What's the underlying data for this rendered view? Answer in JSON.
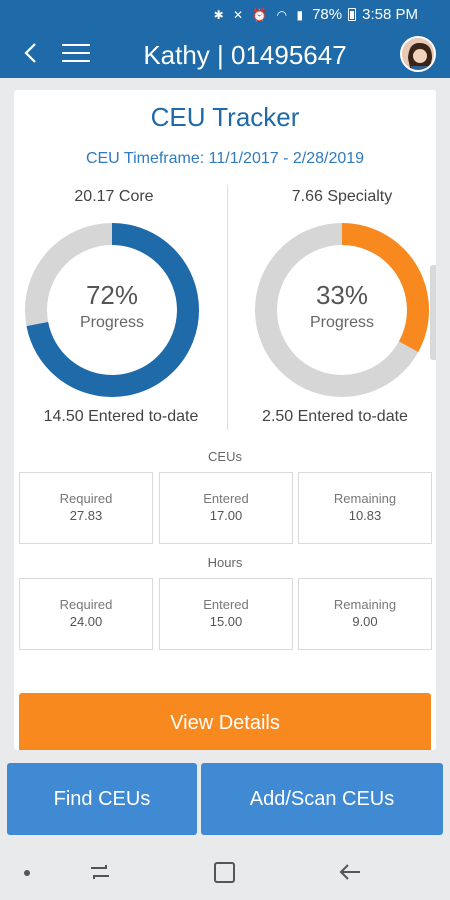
{
  "status_bar": {
    "icons": [
      "bluetooth-icon",
      "mute-icon",
      "alarm-icon",
      "wifi-icon",
      "signal-icon",
      "battery-icon"
    ],
    "battery": "78%",
    "time": "3:58 PM"
  },
  "header": {
    "title": "Kathy | 01495647",
    "accent": "#1f6aa8"
  },
  "tracker": {
    "title": "CEU Tracker",
    "timeframe": "CEU Timeframe: 11/1/2017 - 2/28/2019",
    "core": {
      "heading": "20.17 Core",
      "percent_text": "72%",
      "progress_fraction": 0.72,
      "progress_label": "Progress",
      "entered": "14.50 Entered to-date",
      "color": "#1f6aa8"
    },
    "specialty": {
      "heading": "7.66 Specialty",
      "percent_text": "33%",
      "progress_fraction": 0.33,
      "progress_label": "Progress",
      "entered": "2.50 Entered to-date",
      "color": "#f7891f"
    },
    "ceus": {
      "label": "CEUs",
      "items": [
        {
          "label": "Required",
          "value": "27.83"
        },
        {
          "label": "Entered",
          "value": "17.00"
        },
        {
          "label": "Remaining",
          "value": "10.83"
        }
      ]
    },
    "hours": {
      "label": "Hours",
      "items": [
        {
          "label": "Required",
          "value": "24.00"
        },
        {
          "label": "Entered",
          "value": "15.00"
        },
        {
          "label": "Remaining",
          "value": "9.00"
        }
      ]
    },
    "view_details": "View Details"
  },
  "bottom": {
    "find": "Find CEUs",
    "add": "Add/Scan CEUs"
  },
  "colors": {
    "primary": "#1f6aa8",
    "orange": "#f7891f",
    "button_blue": "#3f8ad3",
    "track_gray": "#d6d6d6"
  }
}
